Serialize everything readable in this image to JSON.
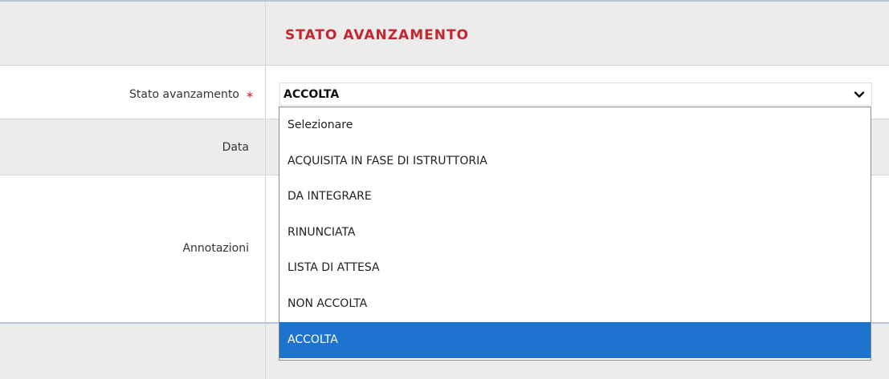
{
  "section": {
    "title": "STATO AVANZAMENTO"
  },
  "fields": {
    "stato": {
      "label": "Stato avanzamento",
      "required_marker": "∗",
      "value": "ACCOLTA"
    },
    "data": {
      "label": "Data"
    },
    "annotazioni": {
      "label": "Annotazioni"
    }
  },
  "dropdown": {
    "selected_index": 7,
    "options": [
      "Selezionare",
      "ACQUISITA IN FASE DI ISTRUTTORIA",
      "DA INTEGRARE",
      "RINUNCIATA",
      "LISTA DI ATTESA",
      "NON ACCOLTA",
      "ACCOLTA"
    ]
  },
  "colors": {
    "section_title": "#c4262e",
    "required_marker": "#d0263a",
    "selected_option_bg": "#1e73cf",
    "row_alt_bg": "#ececec"
  },
  "icons": {
    "select_toggle": "chevron-down-icon"
  }
}
